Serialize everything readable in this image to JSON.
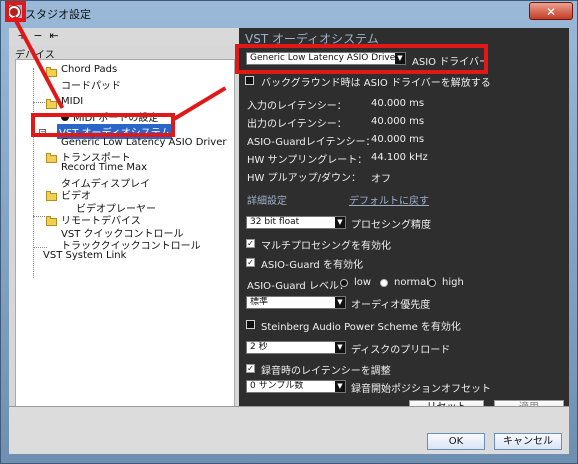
{
  "window": {
    "title": "スタジオ設定",
    "close_symbol": "✕"
  },
  "left": {
    "toolbar": {
      "add": "+",
      "remove": "−",
      "reset": "⇤"
    },
    "devices_label": "デバイス",
    "tree": [
      {
        "label": "Chord Pads",
        "kind": "folder"
      },
      {
        "label": "コードパッド",
        "kind": "item"
      },
      {
        "label": "MIDI",
        "kind": "folder"
      },
      {
        "label": "MIDI ポートの設定",
        "kind": "item"
      },
      {
        "label": "VST オーディオシステム",
        "kind": "selected"
      },
      {
        "label": "Generic Low Latency ASIO Driver",
        "kind": "item"
      },
      {
        "label": "トランスポート",
        "kind": "folder"
      },
      {
        "label": "Record Time Max",
        "kind": "item"
      },
      {
        "label": "タイムディスプレイ",
        "kind": "item"
      },
      {
        "label": "ビデオ",
        "kind": "folder"
      },
      {
        "label": "ビデオプレーヤー",
        "kind": "item"
      },
      {
        "label": "リモートデバイス",
        "kind": "folder"
      },
      {
        "label": "VST クイックコントロール",
        "kind": "item"
      },
      {
        "label": "トラッククイックコントロール",
        "kind": "item"
      },
      {
        "label": "VST System Link",
        "kind": "item"
      }
    ]
  },
  "right": {
    "heading": "VST オーディオシステム",
    "driver": {
      "selected": "Generic Low Latency ASIO Driver",
      "label": "ASIO ドライバー"
    },
    "background_release": "バックグラウンド時は ASIO ドライバーを解放する",
    "info": [
      {
        "label": "入力のレイテンシー：",
        "value": "40.000 ms"
      },
      {
        "label": "出力のレイテンシー：",
        "value": "40.000 ms"
      },
      {
        "label": "ASIO-Guardレイテンシー：",
        "value": "40.000 ms"
      },
      {
        "label": "HW サンプリングレート：",
        "value": "44.100 kHz"
      },
      {
        "label": "HW プルアップ/ダウン：",
        "value": "オフ"
      }
    ],
    "detail_title": "詳細設定",
    "default_link": "デフォルトに戻す",
    "processing_precision": {
      "value": "32 bit float",
      "label": "プロセシング精度"
    },
    "multi_processing": "マルチプロセシングを有効化",
    "asio_guard": "ASIO-Guard を有効化",
    "asio_guard_level": {
      "label": "ASIO-Guard レベル：",
      "options": [
        "low",
        "normal",
        "high"
      ]
    },
    "audio_priority": {
      "value": "標準",
      "label": "オーディオ優先度"
    },
    "power_scheme": "Steinberg Audio Power Scheme を有効化",
    "disk_preload": {
      "value": "2 秒",
      "label": "ディスクのプリロード"
    },
    "adjust_latency": "録音時のレイテンシーを調整",
    "record_offset": {
      "value": "0 サンプル数",
      "label": "録音開始ポジションオフセット"
    },
    "buttons": {
      "reset": "リセット",
      "apply": "適用"
    }
  },
  "footer": {
    "ok": "OK",
    "cancel": "キャンセル"
  },
  "colors": {
    "annotation": "#e01818",
    "selected": "#2b65c9",
    "panel": "#2e2e2e",
    "heading": "#9eb0c8"
  }
}
